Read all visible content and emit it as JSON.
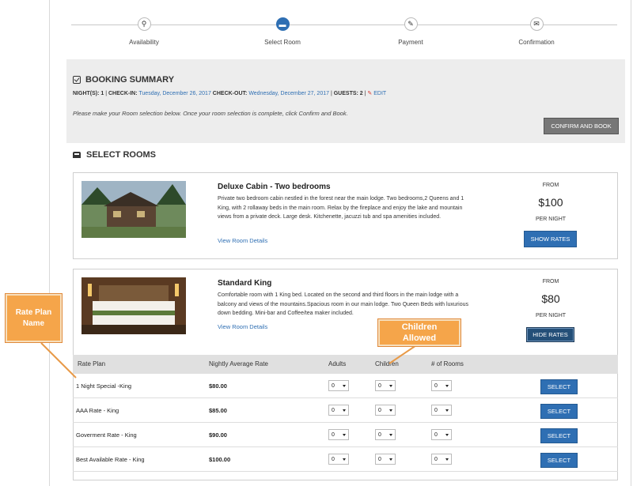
{
  "steps": [
    {
      "label": "Availability",
      "icon": "search-icon"
    },
    {
      "label": "Select Room",
      "icon": "bed-icon"
    },
    {
      "label": "Payment",
      "icon": "pencil-icon"
    },
    {
      "label": "Confirmation",
      "icon": "envelope-icon"
    }
  ],
  "summary": {
    "title": "BOOKING SUMMARY",
    "nights_label": "NIGHT(S): 1",
    "checkin_label": "CHECK-IN:",
    "checkin_value": "Tuesday, December 26, 2017",
    "checkout_label": "CHECK-OUT:",
    "checkout_value": "Wednesday, December 27, 2017",
    "guests_label": "GUESTS: 2",
    "edit_label": "EDIT",
    "note": "Please make your Room selection below. Once your room selection is complete, click Confirm and Book.",
    "confirm_button": "CONFIRM AND BOOK"
  },
  "select_rooms_title": "SELECT ROOMS",
  "rooms": [
    {
      "name": "Deluxe Cabin - Two bedrooms",
      "description": "Private two bedroom cabin nestled in the forest near the main lodge. Two bedrooms,2 Queens and 1 King, with 2 rollaway beds in the main room. Relax by the fireplace and enjoy the lake and mountain views from a private deck. Large desk. Kitchenette, jacuzzi tub and spa amenities included.",
      "details_link": "View Room Details",
      "from_label": "FROM",
      "price": "$100",
      "per_night": "PER NIGHT",
      "button": "SHOW RATES"
    },
    {
      "name": "Standard King",
      "description": "Comfortable room with 1 King bed. Located on the second and third floors in the main lodge with a balcony and views of the mountains.Spacious room in our main lodge. Two Queen Beds with luxurious down bedding. Mini-bar and Coffee/tea maker included.",
      "details_link": "View Room Details",
      "from_label": "FROM",
      "price": "$80",
      "per_night": "PER NIGHT",
      "button": "HIDE RATES"
    }
  ],
  "rates_table": {
    "headers": [
      "Rate Plan",
      "Nightly Average Rate",
      "Adults",
      "Children",
      "# of Rooms"
    ],
    "rows": [
      {
        "plan": "1 Night Special -King",
        "rate": "$80.00",
        "adults": "0",
        "children": "0",
        "rooms": "0",
        "button": "SELECT"
      },
      {
        "plan": "AAA Rate - King",
        "rate": "$85.00",
        "adults": "0",
        "children": "0",
        "rooms": "0",
        "button": "SELECT"
      },
      {
        "plan": "Goverment Rate - King",
        "rate": "$90.00",
        "adults": "0",
        "children": "0",
        "rooms": "0",
        "button": "SELECT"
      },
      {
        "plan": "Best Available Rate - King",
        "rate": "$100.00",
        "adults": "0",
        "children": "0",
        "rooms": "0",
        "button": "SELECT"
      }
    ]
  },
  "callouts": {
    "rate_plan": "Rate Plan Name",
    "children": "Children Allowed"
  },
  "colors": {
    "accent": "#2f6fb3",
    "callout": "#f5a54a",
    "summary_bg": "#ededed"
  }
}
